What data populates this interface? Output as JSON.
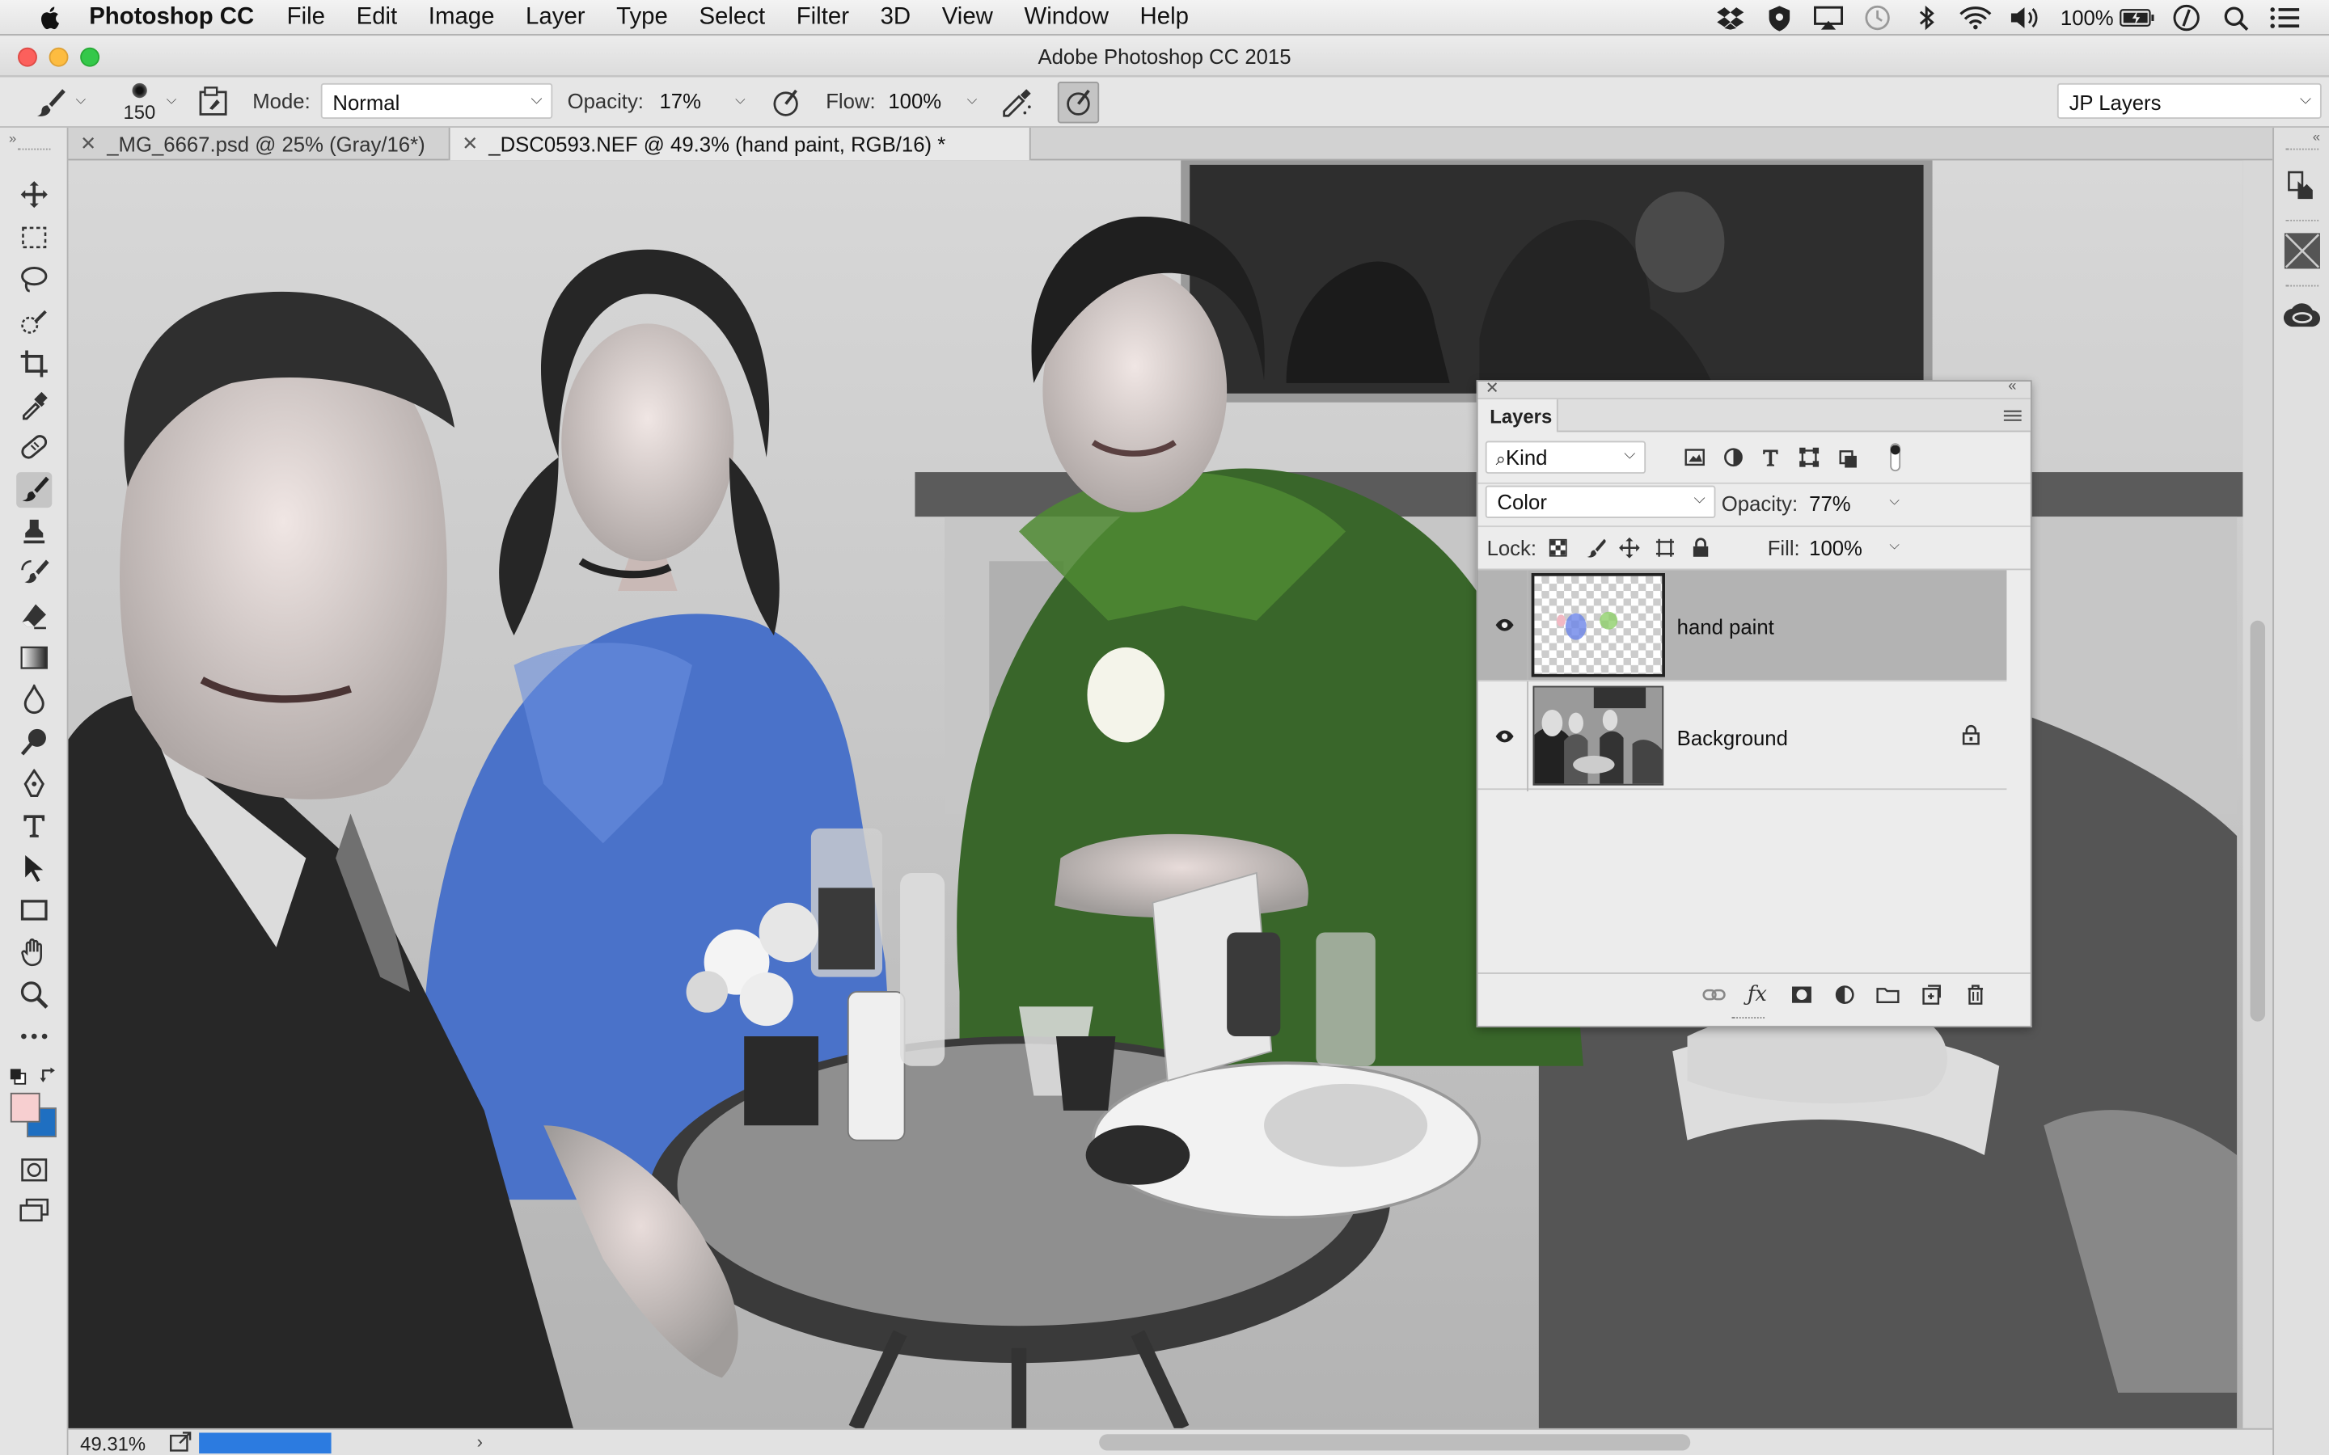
{
  "menubar": {
    "app_name": "Photoshop CC",
    "items": [
      "File",
      "Edit",
      "Image",
      "Layer",
      "Type",
      "Select",
      "Filter",
      "3D",
      "View",
      "Window",
      "Help"
    ],
    "battery": "100%"
  },
  "window": {
    "title": "Adobe Photoshop CC 2015"
  },
  "options": {
    "brush_size": "150",
    "mode_label": "Mode:",
    "mode_value": "Normal",
    "opacity_label": "Opacity:",
    "opacity_value": "17%",
    "flow_label": "Flow:",
    "flow_value": "100%",
    "workspace": "JP Layers"
  },
  "tabs": [
    {
      "label": "_MG_6667.psd @ 25% (Gray/16*)",
      "active": false
    },
    {
      "label": "_DSC0593.NEF @ 49.3% (hand paint, RGB/16) *",
      "active": true
    }
  ],
  "colors": {
    "foreground": "#f7cfd0",
    "background": "#1f6fc1"
  },
  "status": {
    "zoom": "49.31%",
    "progress_fraction": 0.48
  },
  "layers_panel": {
    "title": "Layers",
    "filter_value": "Kind",
    "blend_mode": "Color",
    "opacity_label": "Opacity:",
    "opacity_value": "77%",
    "lock_label": "Lock:",
    "fill_label": "Fill:",
    "fill_value": "100%",
    "layers": [
      {
        "name": "hand paint",
        "selected": true,
        "visible": true,
        "locked": false
      },
      {
        "name": "Background",
        "selected": false,
        "visible": true,
        "locked": true
      }
    ]
  }
}
